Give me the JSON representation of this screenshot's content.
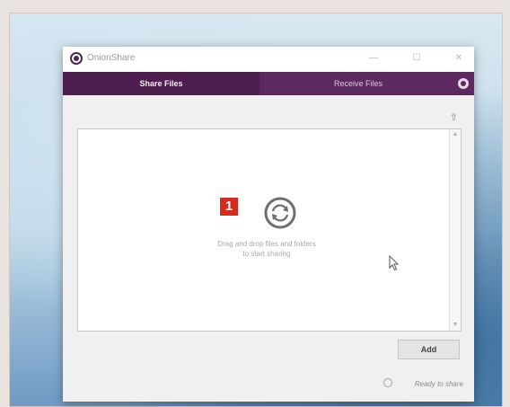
{
  "window": {
    "title": "OnionShare",
    "minimize_glyph": "—",
    "maximize_glyph": "☐",
    "close_glyph": "✕"
  },
  "tabs": [
    {
      "label": "Share Files",
      "active": true
    },
    {
      "label": "Receive Files",
      "active": false
    }
  ],
  "icons": {
    "app": "onionshare-icon",
    "settings": "gear-icon",
    "upload": "upload-icon",
    "drop": "sync-icon",
    "cursor": "mouse-cursor-icon"
  },
  "dropzone": {
    "badge": "1",
    "line1": "Drag and drop files and folders",
    "line2": "to start sharing"
  },
  "buttons": {
    "add": "Add"
  },
  "status": {
    "text": "Ready to share"
  },
  "colors": {
    "tab_bar": "#5c2a5e",
    "tab_active": "#4c1f4f",
    "badge": "#d62a1f"
  }
}
